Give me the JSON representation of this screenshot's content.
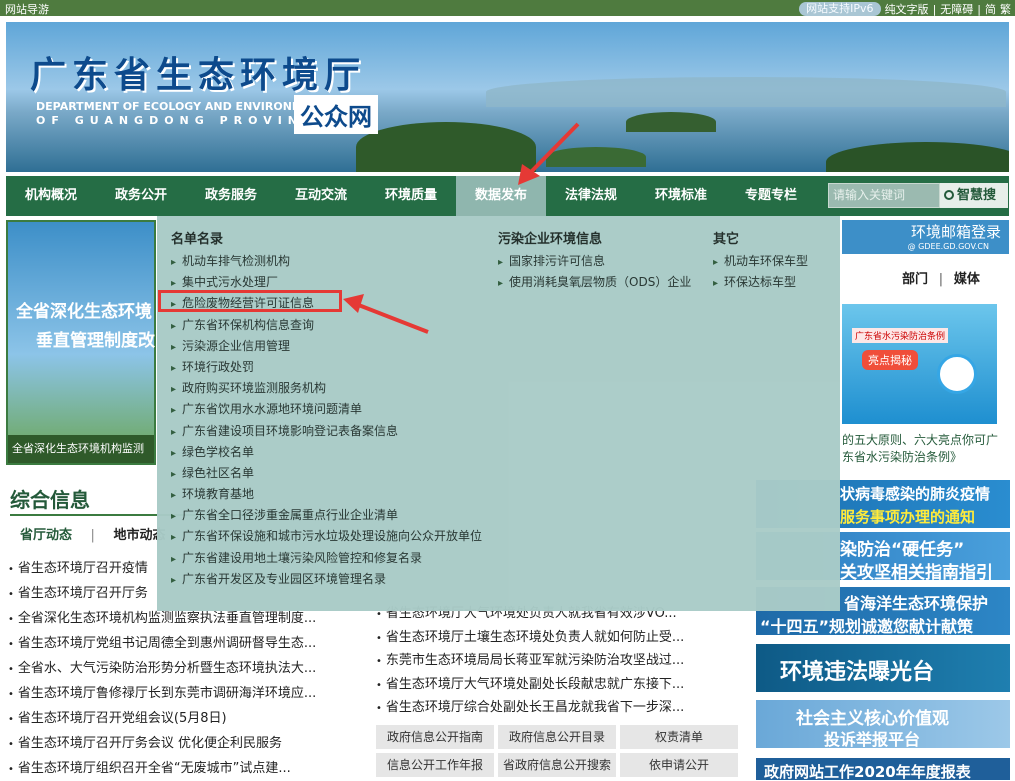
{
  "topbar": {
    "left": "网站导游",
    "ipv6": "网站支持IPv6",
    "links": [
      "纯文字版",
      "|",
      "无障碍",
      "|",
      "简",
      "繁"
    ]
  },
  "banner": {
    "title": "广东省生态环境厅",
    "en_line1": "DEPARTMENT OF ECOLOGY AND ENVIRONMENT",
    "en_line2": "OF GUANGDONG PROVINCE",
    "portal": "公众网"
  },
  "nav": {
    "items": [
      "机构概况",
      "政务公开",
      "政务服务",
      "互动交流",
      "环境质量",
      "数据发布",
      "法律法规",
      "环境标准",
      "专题专栏"
    ],
    "active_index": 5,
    "search_placeholder": "请输入关键词",
    "search_button": "智慧搜"
  },
  "left_image": {
    "caption1": "全省深化生态环境",
    "caption2": "垂直管理制度改",
    "bar": "全省深化生态环境机构监测"
  },
  "right_box": {
    "mailbox": "环境邮箱登录",
    "mailbox_sub": "@ GDEE.GD.GOV.CN",
    "tab1": "部门",
    "sep": "|",
    "tab2": "媒体",
    "poster_tag": "广东省水污染防治条例",
    "poster_btn": "亮点揭秘",
    "poster_caption": "的五大原则、六大亮点你可广东省水污染防治条例》"
  },
  "side_banners": [
    {
      "text1": "状病毒感染的肺炎疫情",
      "text2": "服务事项办理的通知"
    },
    {
      "text1": "染防治“硬任务”",
      "text2": "关攻坚相关指南指引"
    },
    {
      "text1": "省海洋生态环境保护",
      "text2": "“十四五”规划诚邀您献计献策"
    },
    {
      "text1": "环境违法曝光台",
      "text2": ""
    },
    {
      "text1": "社会主义核心价值观",
      "text2": "投诉举报平台"
    },
    {
      "text1": "政府网站工作2020年年度报表",
      "text2": ""
    }
  ],
  "zonghe": {
    "title": "综合信息",
    "tab1": "省厅动态",
    "sep": "|",
    "tab2": "地市动态"
  },
  "news_left": [
    "省生态环境厅召开疫情",
    "省生态环境厅召开厅务",
    "全省深化生态环境机构监测监察执法垂直管理制度...",
    "省生态环境厅党组书记周德全到惠州调研督导生态...",
    "全省水、大气污染防治形势分析暨生态环境执法大...",
    "省生态环境厅鲁修禄厅长到东莞市调研海洋环境应...",
    "省生态环境厅召开党组会议(5月8日)",
    "省生态环境厅召开厅务会议 优化便企利民服务",
    "省生态环境厅组织召开全省“无废城市”试点建..."
  ],
  "news_right": [
    "省生态环境厅大气环境处负责人就我省有效涉VO...",
    "省生态环境厅土壤生态环境处负责人就如何防止受...",
    "东莞市生态环境局局长蒋亚军就污染防治攻坚战过...",
    "省生态环境厅大气环境处副处长段献忠就广东接下...",
    "省生态环境厅综合处副处长王昌龙就我省下一步深..."
  ],
  "buttons": [
    "政府信息公开指南",
    "政府信息公开目录",
    "权责清单",
    "信息公开工作年报",
    "省政府信息公开搜索",
    "依申请公开"
  ],
  "dropdown": {
    "col1": {
      "heading": "名单名录",
      "items": [
        "机动车排气检测机构",
        "集中式污水处理厂",
        "危险废物经营许可证信息",
        "广东省环保机构信息查询",
        "污染源企业信用管理",
        "环境行政处罚",
        "政府购买环境监测服务机构",
        "广东省饮用水水源地环境问题清单",
        "广东省建设项目环境影响登记表备案信息",
        "绿色学校名单",
        "绿色社区名单",
        "环境教育基地",
        "广东省全口径涉重金属重点行业企业清单",
        "广东省环保设施和城市污水垃圾处理设施向公众开放单位",
        "广东省建设用地土壤污染风险管控和修复名录",
        "广东省开发区及专业园区环境管理名录"
      ]
    },
    "col2": {
      "heading": "污染企业环境信息",
      "items": [
        "国家排污许可信息",
        "使用消耗臭氧层物质（ODS）企业"
      ]
    },
    "col3": {
      "heading": "其它",
      "items": [
        "机动车环保车型",
        "环保达标车型"
      ]
    },
    "highlighted_item": "危险废物经营许可证信息"
  },
  "colors": {
    "nav_bg": "#256d45",
    "dropdown_bg": "#a9cbc7",
    "highlight": "#e53935",
    "arrow": "#e53935"
  }
}
